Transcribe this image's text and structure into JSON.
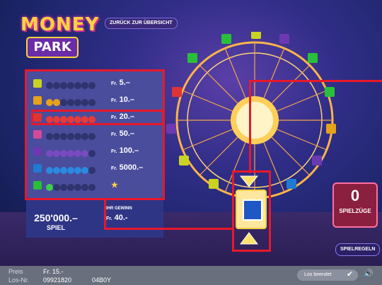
{
  "header": {
    "logo_top": "MONEY",
    "logo_bottom": "PARK",
    "back_button": "ZURÜCK ZUR ÜBERSICHT"
  },
  "prize_table": {
    "rows": [
      {
        "cabin_color": "#c9d321",
        "dot_color": "#3a3f78",
        "prize": "5.–",
        "lit": 0
      },
      {
        "cabin_color": "#e5a21a",
        "dot_color": "#e8a21a",
        "prize": "10.–",
        "lit": 2
      },
      {
        "cabin_color": "#e03333",
        "dot_color": "#e83a3a",
        "prize": "20.–",
        "lit": 7
      },
      {
        "cabin_color": "#d14a9a",
        "dot_color": "#a03a9a",
        "prize": "50.–",
        "lit": 0
      },
      {
        "cabin_color": "#6b3ab0",
        "dot_color": "#7a4ac0",
        "prize": "100.–",
        "lit": 6
      },
      {
        "cabin_color": "#1f7ad0",
        "dot_color": "#2a8ae0",
        "prize": "5000.–",
        "lit": 6
      },
      {
        "cabin_color": "#2abf3a",
        "dot_color": "#3acf4a",
        "prize": "★",
        "lit": 1
      }
    ],
    "currency": "Fr."
  },
  "jackpot": {
    "value": "250'000.–",
    "label": "SPIEL"
  },
  "your_win": {
    "label": "IHR GEWINN",
    "currency": "Fr.",
    "value": "40.-"
  },
  "counter": {
    "value": "0",
    "label": "SPIELZÜGE"
  },
  "rules_button": "SPIELREGELN",
  "footer": {
    "price_label": "Preis",
    "price_value": "Fr. 15.-",
    "lot_label": "Los-Nr.",
    "lot_value": "09921820",
    "lot_code": "04B0Y",
    "status": "Los beendet"
  },
  "icons": {
    "check": "check-icon",
    "speaker": "speaker-icon"
  }
}
